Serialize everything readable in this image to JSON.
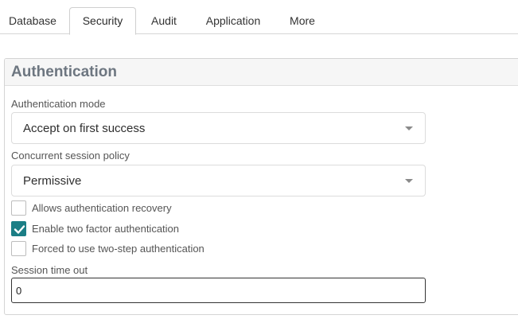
{
  "tabs": [
    {
      "label": "Database",
      "active": false
    },
    {
      "label": "Security",
      "active": true
    },
    {
      "label": "Audit",
      "active": false
    },
    {
      "label": "Application",
      "active": false
    },
    {
      "label": "More",
      "active": false
    }
  ],
  "panel": {
    "title": "Authentication",
    "auth_mode": {
      "label": "Authentication mode",
      "value": "Accept on first success"
    },
    "session_policy": {
      "label": "Concurrent session policy",
      "value": "Permissive"
    },
    "checkboxes": [
      {
        "label": "Allows authentication recovery",
        "checked": false
      },
      {
        "label": "Enable two factor authentication",
        "checked": true
      },
      {
        "label": "Forced to use two-step authentication",
        "checked": false
      }
    ],
    "session_timeout": {
      "label": "Session time out",
      "value": "0"
    }
  },
  "colors": {
    "accent": "#1b7e85",
    "title": "#6d7680"
  },
  "icons": {
    "select_caret": "chevron-down-icon",
    "check": "checkmark-icon"
  }
}
